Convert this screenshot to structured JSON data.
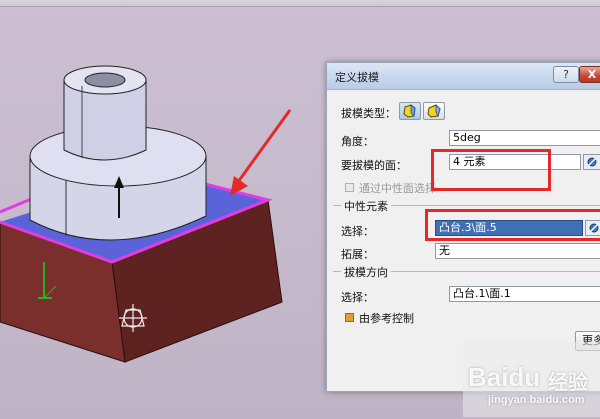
{
  "dialog": {
    "title": "定义拔模",
    "help_button": "?",
    "close_button": "X",
    "draft_type_label": "拔模类型：",
    "angle_label": "角度：",
    "angle_value": "5deg",
    "faces_to_draft_label": "要拔模的面：",
    "faces_to_draft_value": "4 元素",
    "neutral_checkbox_label": "通过中性面选择",
    "neutral_element_group": "中性元素",
    "selection_label": "选择：",
    "selection_value": "凸台.3\\面.5",
    "propagation_label": "拓展：",
    "propagation_value": "无",
    "pulling_direction_group": "拔模方向",
    "direction_selection_label": "选择：",
    "direction_selection_value": "凸台.1\\面.1",
    "controlled_by_reference_label": "由参考控制",
    "more_button": "更多"
  },
  "watermark": {
    "brand": "Baidu",
    "brand_cn": "经验",
    "site": "jingyan.baidu.com"
  },
  "colors": {
    "part_red": "#7b2f2c",
    "selected_face": "#5a63d8",
    "highlight_edge": "#e43ce4",
    "annotation_red": "#e3292a",
    "selection_blue": "#3f6fb4"
  }
}
